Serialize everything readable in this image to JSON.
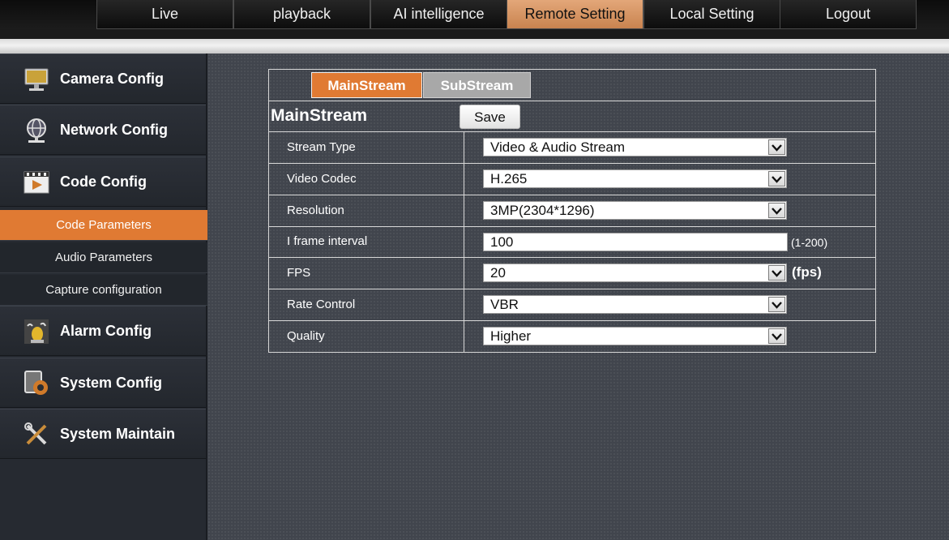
{
  "nav": {
    "tabs": [
      {
        "label": "Live"
      },
      {
        "label": "playback"
      },
      {
        "label": "AI intelligence"
      },
      {
        "label": "Remote Setting",
        "active": true
      },
      {
        "label": "Local Setting"
      },
      {
        "label": "Logout"
      }
    ]
  },
  "sidebar": {
    "categories": [
      {
        "label": "Camera Config",
        "icon": "monitor-icon"
      },
      {
        "label": "Network Config",
        "icon": "globe-network-icon"
      },
      {
        "label": "Code Config",
        "icon": "film-play-icon"
      },
      {
        "label": "Alarm Config",
        "icon": "alarm-siren-icon"
      },
      {
        "label": "System Config",
        "icon": "gear-document-icon"
      },
      {
        "label": "System Maintain",
        "icon": "tools-icon"
      }
    ],
    "sub_items": [
      {
        "label": "Code Parameters",
        "active": true
      },
      {
        "label": "Audio Parameters"
      },
      {
        "label": "Capture configuration"
      }
    ]
  },
  "stream_tabs": {
    "main": "MainStream",
    "sub": "SubStream",
    "active": "MainStream"
  },
  "form": {
    "title": "MainStream",
    "save_label": "Save",
    "rows": {
      "stream_type": {
        "label": "Stream Type",
        "value": "Video & Audio Stream"
      },
      "video_codec": {
        "label": "Video Codec",
        "value": "H.265"
      },
      "resolution": {
        "label": "Resolution",
        "value": "3MP(2304*1296)"
      },
      "i_frame_interval": {
        "label": "I frame interval",
        "value": "100",
        "hint": "(1-200)"
      },
      "fps": {
        "label": "FPS",
        "value": "20",
        "hint": "(fps)"
      },
      "rate_control": {
        "label": "Rate Control",
        "value": "VBR"
      },
      "quality": {
        "label": "Quality",
        "value": "Higher"
      }
    }
  },
  "colors": {
    "accent": "#e07a33",
    "active_nav": "#d8925e",
    "sidebar_bg": "#262a31",
    "main_bg": "#41454d"
  }
}
